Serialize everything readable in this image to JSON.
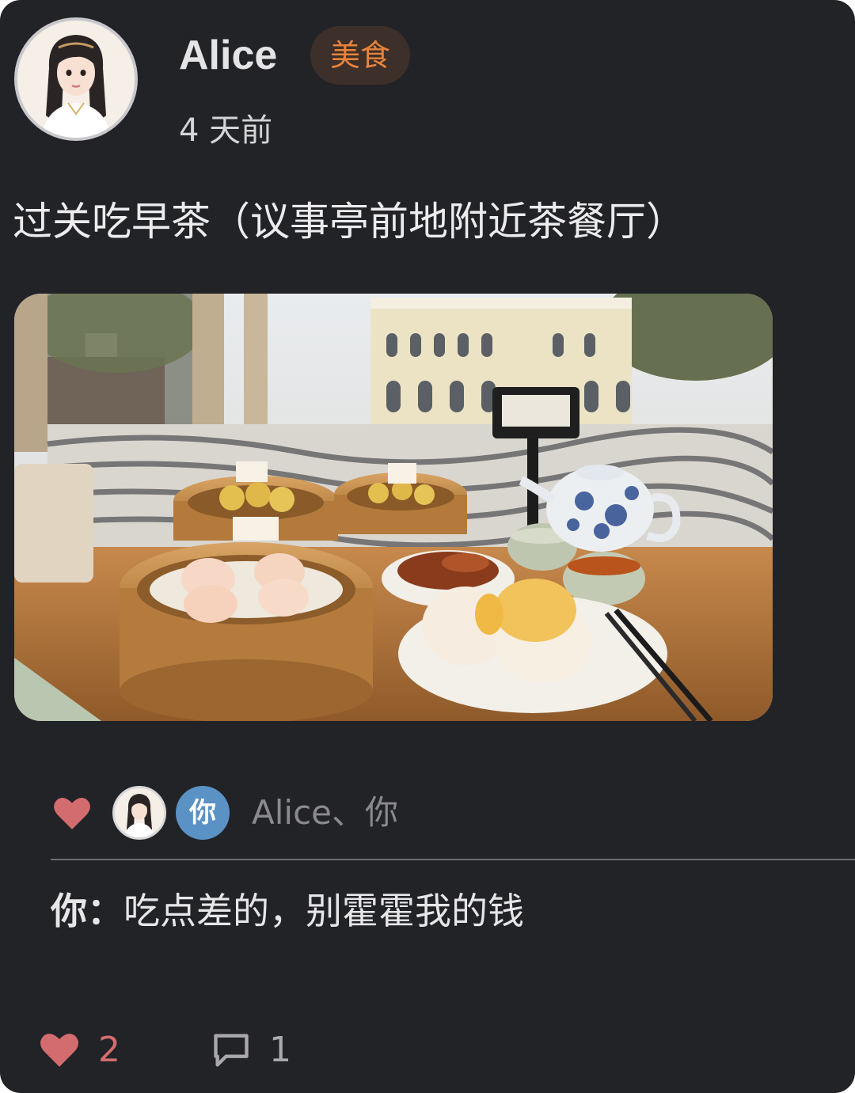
{
  "post": {
    "author": "Alice",
    "tag": "美食",
    "time": "4 天前",
    "text": "过关吃早茶（议事亭前地附近茶餐厅）",
    "photo_labels": [
      "虾饺",
      "烧卖",
      "叉烧包"
    ]
  },
  "likes": {
    "you_avatar_label": "你",
    "names": "Alice、你"
  },
  "comment": {
    "author": "你：",
    "text": "吃点差的，别霍霍我的钱"
  },
  "footer": {
    "like_count": "2",
    "comment_count": "1"
  },
  "colors": {
    "card_bg": "#222327",
    "tag_bg": "#3d2f29",
    "tag_text": "#e9833b",
    "heart": "#d36c6e",
    "you_avatar": "#5b92c6"
  },
  "icons": {
    "like": "heart-icon",
    "comment": "speech-bubble-icon"
  }
}
